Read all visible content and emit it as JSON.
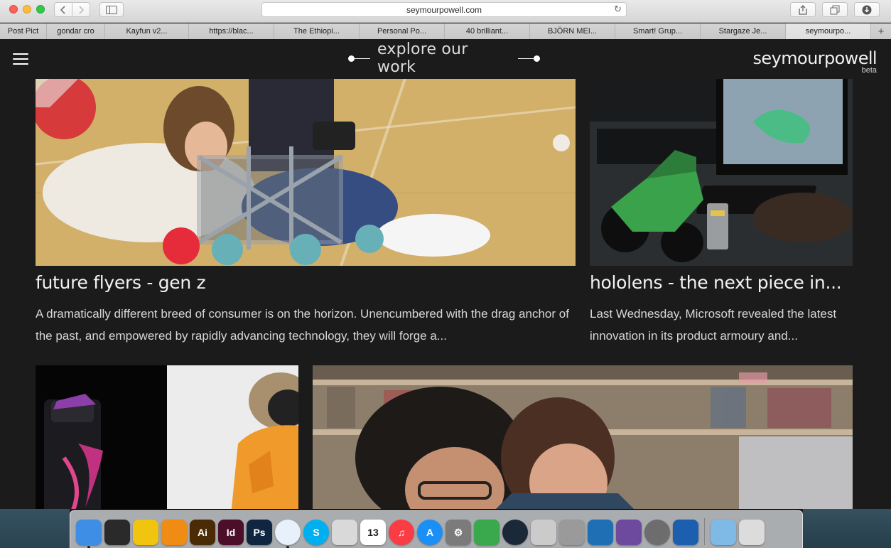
{
  "browser": {
    "url": "seymourpowell.com",
    "tabs": [
      {
        "label": "Post Pict",
        "width": 66
      },
      {
        "label": "gondar cro",
        "width": 82
      },
      {
        "label": "Kayfun v2...",
        "width": 118
      },
      {
        "label": "https://blac...",
        "width": 120
      },
      {
        "label": "The Ethiopi...",
        "width": 120
      },
      {
        "label": "Personal Po...",
        "width": 120
      },
      {
        "label": "40 brilliant...",
        "width": 120
      },
      {
        "label": "BJÖRN MEI...",
        "width": 120
      },
      {
        "label": "Smart! Grup...",
        "width": 120
      },
      {
        "label": "Stargaze Je...",
        "width": 120
      },
      {
        "label": "seymourpo...",
        "width": 120,
        "active": true
      }
    ],
    "tab_add": "+"
  },
  "header": {
    "explore_label": "explore our work",
    "logo_name": "seymourpowell",
    "logo_beta": "beta"
  },
  "cards": [
    {
      "title": "future flyers - gen z",
      "description": "A dramatically different breed of consumer is on the horizon. Unencumbered with the drag anchor of the past, and empowered by rapidly advancing technology, they will forge a..."
    },
    {
      "title": "hololens - the next piece in...",
      "description": "Last Wednesday, Microsoft revealed the latest innovation in its product armoury and..."
    }
  ],
  "dock": {
    "items": [
      {
        "name": "finder-icon",
        "label": "",
        "bg": "#3e8ee6",
        "running": true
      },
      {
        "name": "mission-control-icon",
        "label": "",
        "bg": "#2a2a2a"
      },
      {
        "name": "cyberduck-icon",
        "label": "",
        "bg": "#f1c40f"
      },
      {
        "name": "vlc-icon",
        "label": "",
        "bg": "#f08c14"
      },
      {
        "name": "illustrator-icon",
        "label": "Ai",
        "bg": "#4a2b05"
      },
      {
        "name": "indesign-icon",
        "label": "Id",
        "bg": "#4b0f2a"
      },
      {
        "name": "photoshop-icon",
        "label": "Ps",
        "bg": "#0f2540"
      },
      {
        "name": "safari-icon",
        "label": "",
        "bg": "#e8f1fb",
        "running": true
      },
      {
        "name": "skype-icon",
        "label": "S",
        "bg": "#00aff0"
      },
      {
        "name": "joystick-icon",
        "label": "",
        "bg": "#d9d9d9"
      },
      {
        "name": "calendar-icon",
        "label": "13",
        "bg": "#ffffff"
      },
      {
        "name": "itunes-icon",
        "label": "♫",
        "bg": "#fc3c44"
      },
      {
        "name": "app-store-icon",
        "label": "A",
        "bg": "#1a8ff5"
      },
      {
        "name": "system-preferences-icon",
        "label": "⚙",
        "bg": "#7b7b7b"
      },
      {
        "name": "potion-icon",
        "label": "",
        "bg": "#3aa84c"
      },
      {
        "name": "steam-icon",
        "label": "",
        "bg": "#1b2838"
      },
      {
        "name": "printer-icon",
        "label": "",
        "bg": "#cbcbcb"
      },
      {
        "name": "owl-icon",
        "label": "",
        "bg": "#9a9a9a"
      },
      {
        "name": "frame-icon",
        "label": "",
        "bg": "#1f6fb5"
      },
      {
        "name": "github-icon",
        "label": "",
        "bg": "#6e4a9e"
      },
      {
        "name": "mammoth-icon",
        "label": "",
        "bg": "#6d6d6d"
      },
      {
        "name": "openoffice-icon",
        "label": "",
        "bg": "#1b5fae"
      },
      {
        "name": "folder-icon",
        "label": "",
        "bg": "#7fb9e6",
        "separator_before": true
      },
      {
        "name": "trash-icon",
        "label": "",
        "bg": "#dcdcdc"
      }
    ]
  }
}
